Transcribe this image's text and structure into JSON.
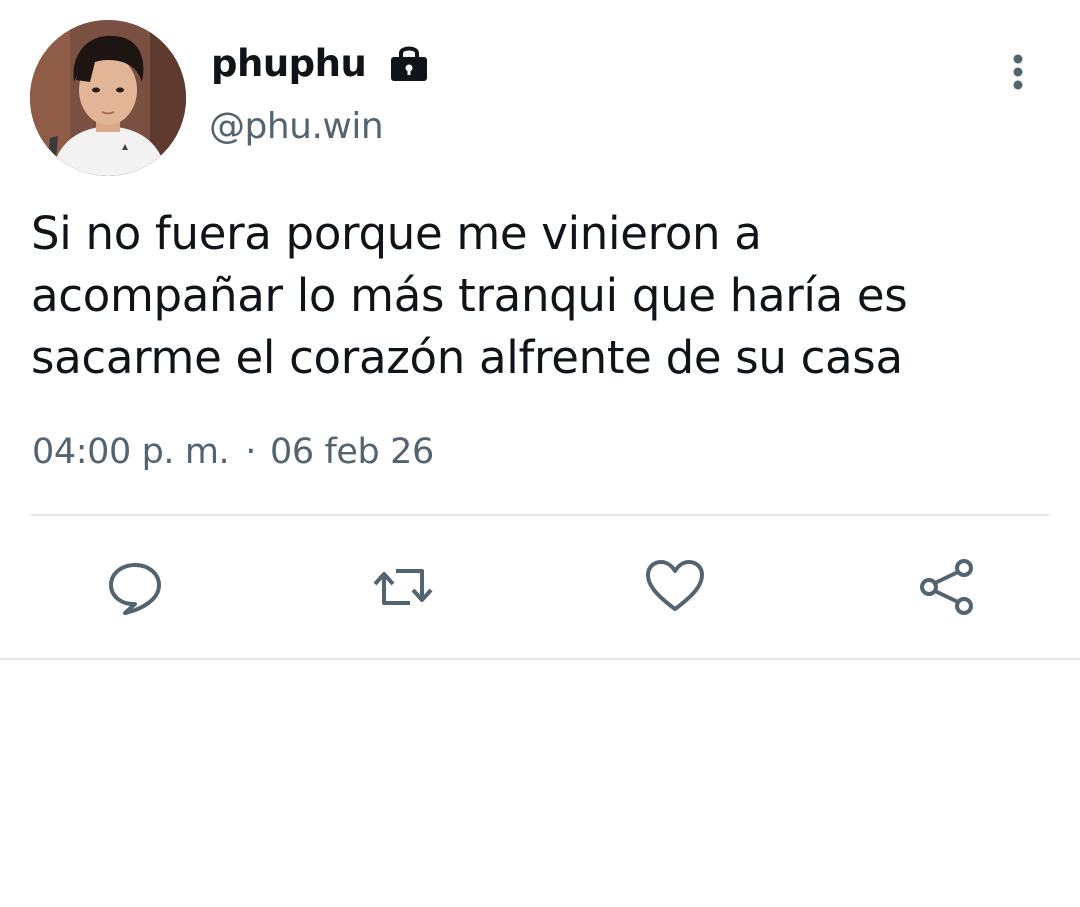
{
  "user": {
    "display_name": "phuphu",
    "handle": "@phu.win",
    "avatar_icon": "profile-photo",
    "protected_icon": "lock-icon"
  },
  "tweet": {
    "text": "Si no fuera porque me vinieron a\nacompañar lo más tranqui que haría es\nsacarme el corazón alfrente de su casa",
    "time": "04:00 p. m.",
    "separator": "·",
    "date": "06 feb 26"
  },
  "actions": {
    "reply_icon": "reply-icon",
    "retweet_icon": "retweet-icon",
    "like_icon": "heart-icon",
    "share_icon": "share-icon"
  },
  "colors": {
    "text": "#0f1419",
    "secondary": "#536471",
    "divider": "#e6e9eb"
  }
}
